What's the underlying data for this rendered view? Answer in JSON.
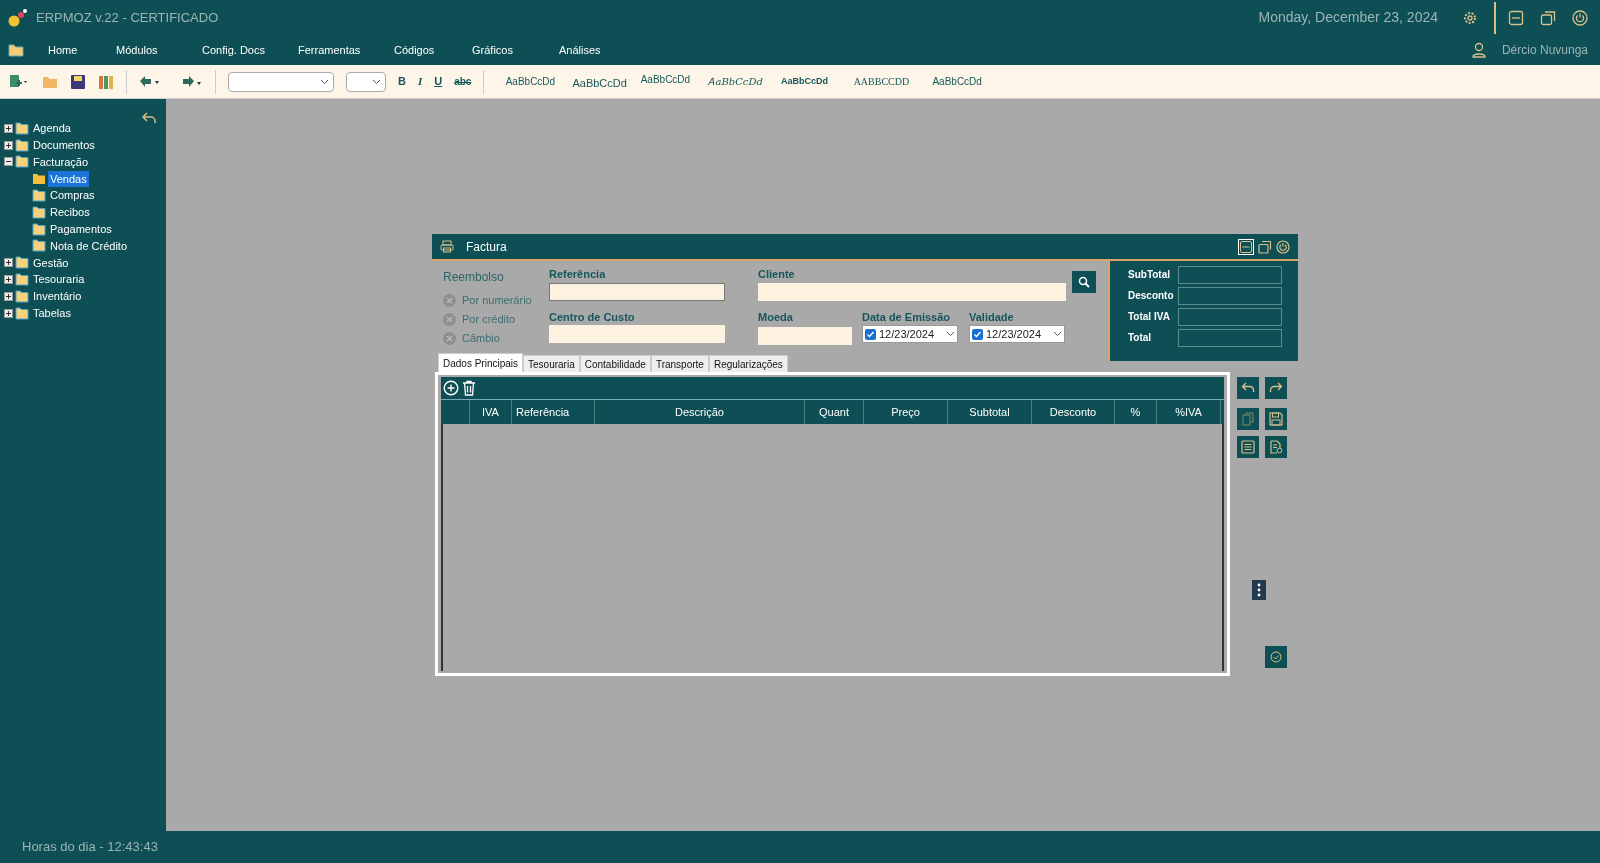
{
  "app": {
    "title": "ERPMOZ v.22 - CERTIFICADO",
    "date": "Monday, December 23, 2024",
    "user": "Dércio Nuvunga"
  },
  "menu": [
    {
      "label": "Home"
    },
    {
      "label": "Módulos"
    },
    {
      "label": "Config. Docs"
    },
    {
      "label": "Ferramentas"
    },
    {
      "label": "Códigos"
    },
    {
      "label": "Gráficos"
    },
    {
      "label": "Análises"
    }
  ],
  "toolbar": {
    "format_buttons": [
      {
        "label": "B",
        "kind": "bold"
      },
      {
        "label": "I",
        "kind": "italic"
      },
      {
        "label": "U",
        "kind": "underline"
      },
      {
        "label": "abc",
        "kind": "strike"
      }
    ],
    "style_samples": [
      {
        "label": "AaBbCcDd",
        "kind": "normal"
      },
      {
        "label": "AaBbCcDd",
        "kind": "large"
      },
      {
        "label": "AaBbCcDd",
        "kind": "raised"
      },
      {
        "label": "ᎪaBbCcDd",
        "kind": "fancy"
      },
      {
        "label": "AaBbCcDd",
        "kind": "bold"
      },
      {
        "label": "AABBCCDD",
        "kind": "caps"
      },
      {
        "label": "AaBbCcDd",
        "kind": "normal"
      }
    ]
  },
  "sidebar": {
    "items": [
      {
        "label": "Agenda",
        "expanded": false,
        "selected": false
      },
      {
        "label": "Documentos",
        "expanded": false,
        "selected": false
      },
      {
        "label": "Facturação",
        "expanded": true,
        "selected": false,
        "children": [
          {
            "label": "Vendas",
            "selected": true
          },
          {
            "label": "Compras",
            "selected": false
          },
          {
            "label": "Recibos",
            "selected": false
          },
          {
            "label": "Pagamentos",
            "selected": false
          },
          {
            "label": "Nota de Crédito",
            "selected": false
          }
        ]
      },
      {
        "label": "Gestão",
        "expanded": false,
        "selected": false
      },
      {
        "label": "Tesouraria",
        "expanded": false,
        "selected": false
      },
      {
        "label": "Inventário",
        "expanded": false,
        "selected": false
      },
      {
        "label": "Tabelas",
        "expanded": false,
        "selected": false
      }
    ]
  },
  "window": {
    "title": "Factura",
    "refund": {
      "label": "Reembolso",
      "options": [
        {
          "label": "Por numerário",
          "checked": false
        },
        {
          "label": "Por crédito",
          "checked": false
        },
        {
          "label": "Câmbio",
          "checked": false
        }
      ]
    },
    "fields": {
      "reference": "Referência",
      "client": "Cliente",
      "cost_center": "Centro de Custo",
      "currency": "Moeda"
    },
    "dates": [
      {
        "label": "Data de Emissão",
        "value": "12/23/2024",
        "checked": true
      },
      {
        "label": "Validade",
        "value": "12/23/2024",
        "checked": true
      }
    ],
    "totals": [
      {
        "label": "SubTotal"
      },
      {
        "label": "Desconto"
      },
      {
        "label": "Total IVA"
      },
      {
        "label": "Total"
      }
    ],
    "tabs": [
      {
        "label": "Dados Principais",
        "selected": true
      },
      {
        "label": "Tesouraria",
        "selected": false
      },
      {
        "label": "Contabilidade",
        "selected": false
      },
      {
        "label": "Transporte",
        "selected": false
      },
      {
        "label": "Regularizações",
        "selected": false
      }
    ],
    "table": {
      "columns": [
        "IVA",
        "Referência",
        "Descrição",
        "Quant",
        "Preço",
        "Subtotal",
        "Desconto",
        "%",
        "%IVA"
      ]
    }
  },
  "footer": {
    "clock": "Horas do dia - 12:43:43"
  }
}
